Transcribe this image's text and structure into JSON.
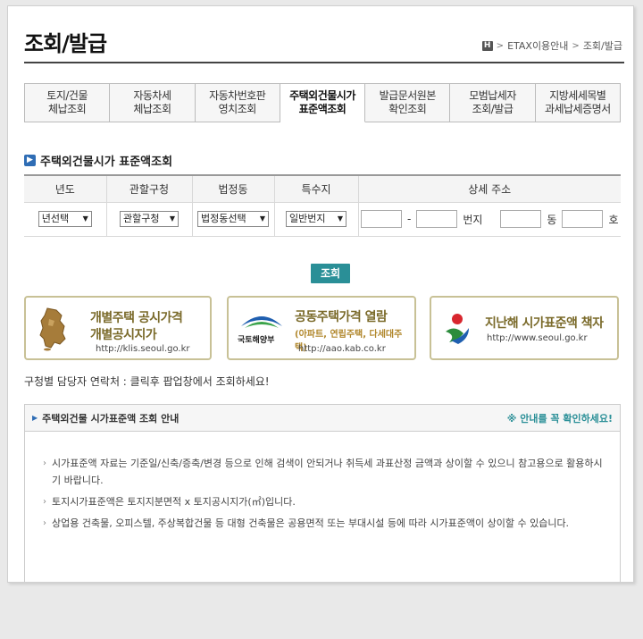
{
  "header": {
    "title": "조회/발급",
    "breadcrumb": [
      "H",
      "ETAX이용안내",
      "조회/발급"
    ]
  },
  "tabs": [
    {
      "label": "토지/건물\n체납조회",
      "active": false
    },
    {
      "label": "자동차세\n체납조회",
      "active": false
    },
    {
      "label": "자동차번호판\n영치조회",
      "active": false
    },
    {
      "label": "주택외건물시가\n표준액조회",
      "active": true
    },
    {
      "label": "발급문서원본\n확인조회",
      "active": false
    },
    {
      "label": "모범납세자\n조회/발급",
      "active": false
    },
    {
      "label": "지방세세목별\n과세납세증명서",
      "active": false
    }
  ],
  "section": {
    "title": "주택외건물시가 표준액조회"
  },
  "search": {
    "headers": [
      "년도",
      "관할구청",
      "법정동",
      "특수지",
      "상세 주소"
    ],
    "year_select": "년선택",
    "gu_select": "관할구청",
    "dong_select": "법정동선택",
    "special_select": "일반번지",
    "dash": "-",
    "bunji_label": "번지",
    "dong_label": "동",
    "ho_label": "호",
    "dropdown_glyph": "▼",
    "button_label": "조회"
  },
  "banners": [
    {
      "title": "개별주택 공시가격",
      "subtitle": "개별공시지가",
      "url": "http://klis.seoul.go.kr"
    },
    {
      "title": "공동주택가격 열람",
      "subtitle": "(아파트, 연립주택, 다세대주택)",
      "url": "http://aao.kab.co.kr",
      "logo_text": "국토해양부"
    },
    {
      "title": "지난해 시가표준액 책자",
      "url": "http://www.seoul.go.kr"
    }
  ],
  "contact_text": "구청별 담당자 연락처 : 클릭후 팝업창에서 조회하세요!",
  "info": {
    "title": "주택외건물 시가표준액 조회 안내",
    "notice": "※ 안내를 꼭 확인하세요!",
    "items": [
      "시가표준액 자료는 기준일/신축/증축/변경 등으로 인해 검색이 안되거나 취득세 과표산정 금액과 상이할 수 있으니 참고용으로 활용하시기 바랍니다.",
      "토지시가표준액은 토지지분면적 x 토지공시지가(㎡)입니다.",
      "상업용 건축물, 오피스텔, 주상복합건물 등 대형 건축물은 공용면적 또는 부대시설 등에 따라 시가표준액이 상이할 수 있습니다."
    ]
  },
  "colors": {
    "accent_teal": "#2a8f97",
    "banner_border": "#c8c196",
    "icon_blue": "#2f6db5"
  }
}
